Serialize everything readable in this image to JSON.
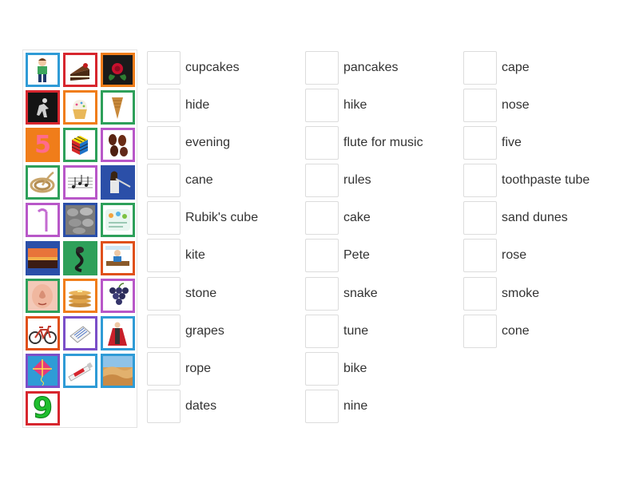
{
  "tiles": [
    {
      "name": "tile-boy",
      "icon": "boy-icon",
      "border": "#2f9bd6",
      "bg": "#ffffff"
    },
    {
      "name": "tile-cupcakes",
      "icon": "chocolate-cake-icon",
      "border": "#d7262e",
      "bg": "#ffffff"
    },
    {
      "name": "tile-rose",
      "icon": "rose-icon",
      "border": "#f07d1a",
      "bg": "#1a1a1a"
    },
    {
      "name": "tile-hide",
      "icon": "hiding-figure-icon",
      "border": "#d7262e",
      "bg": "#111111"
    },
    {
      "name": "tile-cupcake",
      "icon": "cupcake-icon",
      "border": "#f07d1a",
      "bg": "#ffffff"
    },
    {
      "name": "tile-cone",
      "icon": "ice-cream-cone-icon",
      "border": "#2ea05a",
      "bg": "#ffffff"
    },
    {
      "name": "tile-five",
      "icon": "number-five-icon",
      "border": "#f07d1a",
      "bg": "#f07d1a",
      "text": "5"
    },
    {
      "name": "tile-rubiks",
      "icon": "rubiks-cube-icon",
      "border": "#2ea05a",
      "bg": "#ffffff"
    },
    {
      "name": "tile-dates",
      "icon": "dates-fruit-icon",
      "border": "#b857c8",
      "bg": "#ffffff"
    },
    {
      "name": "tile-rope",
      "icon": "rope-coil-icon",
      "border": "#2ea05a",
      "bg": "#ffffff"
    },
    {
      "name": "tile-tune",
      "icon": "music-notes-icon",
      "border": "#b857c8",
      "bg": "#ffffff"
    },
    {
      "name": "tile-flute",
      "icon": "flute-player-icon",
      "border": "#2b4fa8",
      "bg": "#2b4fa8"
    },
    {
      "name": "tile-cane",
      "icon": "walking-cane-icon",
      "border": "#b857c8",
      "bg": "#ffffff"
    },
    {
      "name": "tile-stone",
      "icon": "stones-icon",
      "border": "#2b4fa8",
      "bg": "#8a8a8a"
    },
    {
      "name": "tile-rules",
      "icon": "rules-poster-icon",
      "border": "#2ea05a",
      "bg": "#ffffff"
    },
    {
      "name": "tile-dunes",
      "icon": "sunset-dunes-icon",
      "border": "#2b4fa8",
      "bg": "#2b4fa8"
    },
    {
      "name": "tile-snake",
      "icon": "cobra-snake-icon",
      "border": "#2ea05a",
      "bg": "#2ea05a"
    },
    {
      "name": "tile-pete",
      "icon": "pete-person-icon",
      "border": "#e0501b",
      "bg": "#ffffff"
    },
    {
      "name": "tile-nose",
      "icon": "nose-face-icon",
      "border": "#2ea05a",
      "bg": "#f3c9b8"
    },
    {
      "name": "tile-pancakes",
      "icon": "pancakes-icon",
      "border": "#f07d1a",
      "bg": "#ffffff"
    },
    {
      "name": "tile-grapes",
      "icon": "grapes-icon",
      "border": "#b857c8",
      "bg": "#ffffff"
    },
    {
      "name": "tile-bike",
      "icon": "bicycle-icon",
      "border": "#e0501b",
      "bg": "#ffffff"
    },
    {
      "name": "tile-smoke",
      "icon": "smoke-note-icon",
      "border": "#7b4fc8",
      "bg": "#ffffff"
    },
    {
      "name": "tile-cape",
      "icon": "red-cape-icon",
      "border": "#2f9bd6",
      "bg": "#ffffff"
    },
    {
      "name": "tile-kite",
      "icon": "kite-icon",
      "border": "#7b4fc8",
      "bg": "#2f9bd6"
    },
    {
      "name": "tile-toothpaste",
      "icon": "toothpaste-tube-icon",
      "border": "#2f9bd6",
      "bg": "#ffffff"
    },
    {
      "name": "tile-desert",
      "icon": "sand-dunes-icon",
      "border": "#2f9bd6",
      "bg": "#d9a25b"
    },
    {
      "name": "tile-nine",
      "icon": "number-nine-icon",
      "border": "#d7262e",
      "bg": "#ffffff",
      "text": "9"
    }
  ],
  "columns": [
    [
      "cupcakes",
      "hide",
      "evening",
      "cane",
      "Rubik's cube",
      "kite",
      "stone",
      "grapes",
      "rope",
      "dates"
    ],
    [
      "pancakes",
      "hike",
      "flute for music",
      "rules",
      "cake",
      "Pete",
      "snake",
      "tune",
      "bike",
      "nine"
    ],
    [
      "cape",
      "nose",
      "five",
      "toothpaste tube",
      "sand dunes",
      "rose",
      "smoke",
      "cone"
    ]
  ]
}
